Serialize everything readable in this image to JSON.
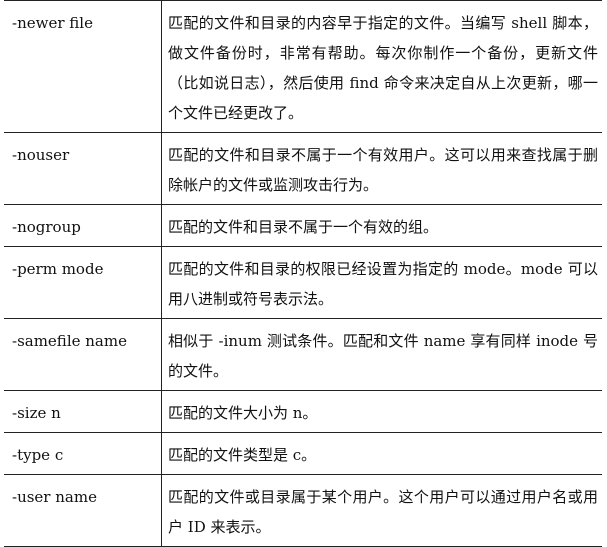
{
  "rows": [
    {
      "option": "-newer file",
      "description": "匹配的文件和目录的内容早于指定的文件。当编写 shell 脚本，做文件备份时，非常有帮助。每次你制作一个备份，更新文件（比如说日志），然后使用 find 命令来决定自从上次更新，哪一个文件已经更改了。"
    },
    {
      "option": "-nouser",
      "description": "匹配的文件和目录不属于一个有效用户。这可以用来查找属于删除帐户的文件或监测攻击行为。"
    },
    {
      "option": "-nogroup",
      "description": "匹配的文件和目录不属于一个有效的组。"
    },
    {
      "option": "-perm mode",
      "description": "匹配的文件和目录的权限已经设置为指定的 mode。mode 可以用八进制或符号表示法。"
    },
    {
      "option": "-samefile name",
      "description": "相似于 -inum 测试条件。匹配和文件 name 享有同样 inode 号的文件。"
    },
    {
      "option": "-size n",
      "description": "匹配的文件大小为 n。"
    },
    {
      "option": "-type c",
      "description": "匹配的文件类型是 c。"
    },
    {
      "option": "-user name",
      "description": "匹配的文件或目录属于某个用户。这个用户可以通过用户名或用户 ID 来表示。"
    }
  ]
}
